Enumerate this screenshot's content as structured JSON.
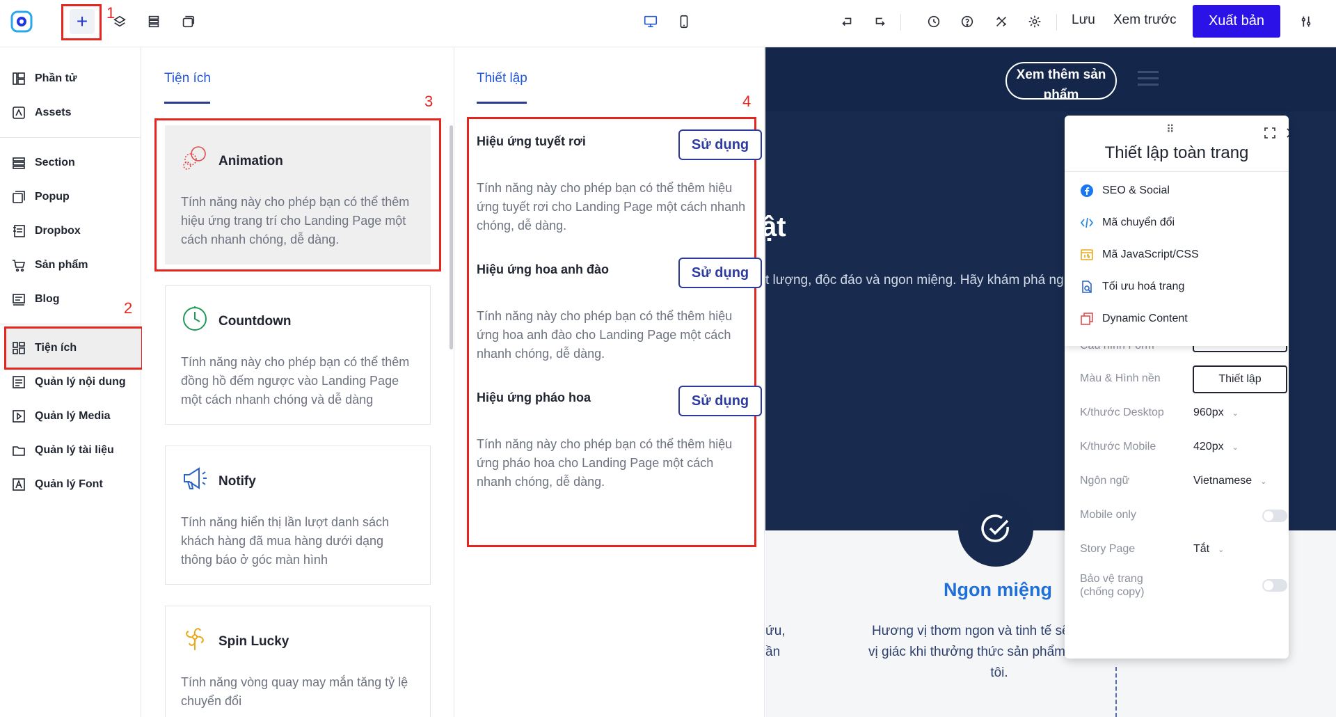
{
  "topbar": {
    "add_label": "+",
    "save_label": "Lưu",
    "preview_label": "Xem trước",
    "publish_label": "Xuất bản"
  },
  "annotations": [
    "1",
    "2",
    "3",
    "4"
  ],
  "leftnav": {
    "items": [
      {
        "label": "Phần tử",
        "icon": "elements-icon"
      },
      {
        "label": "Assets",
        "icon": "assets-icon"
      },
      {
        "label": "Section",
        "icon": "section-icon"
      },
      {
        "label": "Popup",
        "icon": "popup-icon"
      },
      {
        "label": "Dropbox",
        "icon": "dropbox-icon"
      },
      {
        "label": "Sản phẩm",
        "icon": "cart-icon"
      },
      {
        "label": "Blog",
        "icon": "blog-icon"
      },
      {
        "label": "Tiện ích",
        "icon": "widgets-icon"
      },
      {
        "label": "Quản lý nội dung",
        "icon": "content-icon"
      },
      {
        "label": "Quản lý Media",
        "icon": "media-icon"
      },
      {
        "label": "Quản lý tài liệu",
        "icon": "folder-icon"
      },
      {
        "label": "Quản lý Font",
        "icon": "font-icon"
      }
    ]
  },
  "widgets_panel": {
    "tab": "Tiện ích",
    "cards": [
      {
        "title": "Animation",
        "desc": "Tính năng này cho phép bạn có thể thêm hiệu ứng trang trí cho Landing Page một cách nhanh chóng, dễ dàng."
      },
      {
        "title": "Countdown",
        "desc": "Tính năng này cho phép bạn có thể thêm đồng hồ đếm ngược vào Landing Page một cách nhanh chóng và dễ dàng"
      },
      {
        "title": "Notify",
        "desc": "Tính năng hiển thị lần lượt danh sách khách hàng đã mua hàng dưới dạng thông báo ở góc màn hình"
      },
      {
        "title": "Spin Lucky",
        "desc": "Tính năng vòng quay may mắn tăng tỷ lệ chuyển đổi"
      }
    ]
  },
  "settings_panel": {
    "tab": "Thiết lập",
    "effects": [
      {
        "title": "Hiệu ứng tuyết rơi",
        "button": "Sử dụng",
        "desc": "Tính năng này cho phép bạn có thể thêm hiệu ứng tuyết rơi cho Landing Page một cách nhanh chóng, dễ dàng."
      },
      {
        "title": "Hiệu ứng hoa anh đào",
        "button": "Sử dụng",
        "desc": "Tính năng này cho phép bạn có thể thêm hiệu ứng hoa anh đào cho Landing Page một cách nhanh chóng, dễ dàng."
      },
      {
        "title": "Hiệu ứng pháo hoa",
        "button": "Sử dụng",
        "desc": "Tính năng này cho phép bạn có thể thêm hiệu ứng pháo hoa cho Landing Page một cách nhanh chóng, dễ dàng."
      }
    ]
  },
  "canvas": {
    "more_button": "Xem thêm sản phẩm",
    "hero_title": "ật",
    "hero_sub": "t lượng, độc đáo và ngon miệng. Hãy khám phá ng",
    "section_title": "Ngon miệng",
    "section_desc": "Hương vị thơm ngon và tinh tế sẽ phục mọi vị giác khi thưởng thức sản phẩm của chúng tôi.",
    "left_fragment_1": "ứu,",
    "left_fragment_2": "ần"
  },
  "page_settings": {
    "title": "Thiết lập toàn trang",
    "menu": [
      {
        "label": "SEO & Social",
        "icon": "facebook-icon"
      },
      {
        "label": "Mã chuyển đổi",
        "icon": "code-icon"
      },
      {
        "label": "Mã JavaScript/CSS",
        "icon": "js-icon"
      },
      {
        "label": "Tối ưu hoá trang",
        "icon": "optimize-icon"
      },
      {
        "label": "Dynamic Content",
        "icon": "dynamic-icon"
      }
    ],
    "hidden_label": "Cấu hình Form",
    "rows": {
      "bg_label": "Màu & Hình nền",
      "bg_button": "Thiết lập",
      "desktop_label": "K/thước Desktop",
      "desktop_value": "960px",
      "mobile_label": "K/thước Mobile",
      "mobile_value": "420px",
      "lang_label": "Ngôn ngữ",
      "lang_value": "Vietnamese",
      "mobile_only_label": "Mobile only",
      "story_label": "Story Page",
      "story_value": "Tắt",
      "protect_label_1": "Bảo vệ trang",
      "protect_label_2": "(chống copy)"
    }
  },
  "colors": {
    "accent": "#2b12e6",
    "highlight": "#e5261f",
    "link": "#2356d8",
    "hero_bg": "#182b4f"
  }
}
